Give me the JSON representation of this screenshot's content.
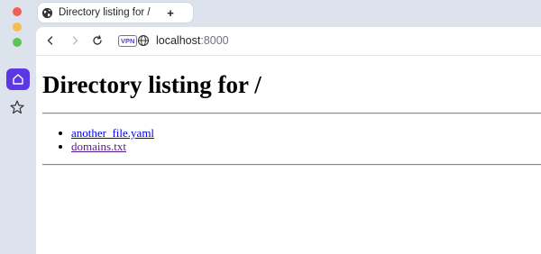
{
  "browser": {
    "tab_title": "Directory listing for /",
    "new_tab_icon": "+",
    "vpn_badge": "VPN",
    "url_host": "localhost",
    "url_port": ":8000"
  },
  "page": {
    "heading": "Directory listing for /",
    "files": [
      {
        "name": "another_file.yaml",
        "visited": false
      },
      {
        "name": "domains.txt",
        "visited": true
      }
    ]
  },
  "colors": {
    "accent": "#5b37e6",
    "link": "#0000ee",
    "link_visited": "#551a8b",
    "window_chrome": "#dde3ec"
  },
  "icons": {
    "tab_favicon": "globe-icon",
    "sidebar_home": "home-icon",
    "sidebar_favorites": "star-icon",
    "back": "arrow-left-icon",
    "forward": "arrow-right-icon",
    "reload": "reload-icon",
    "site_info": "globe-icon"
  }
}
